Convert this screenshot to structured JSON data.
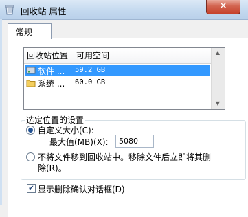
{
  "window": {
    "title": "回收站 属性",
    "close_glyph": "✕"
  },
  "tabs": [
    {
      "label": "常规"
    }
  ],
  "list": {
    "headers": {
      "location": "回收站位置",
      "space": "可用空间"
    },
    "rows": [
      {
        "name": "软件 ...",
        "space": "59.2 GB",
        "selected": true
      },
      {
        "name": "系统 ...",
        "space": "60.0 GB",
        "selected": false
      }
    ]
  },
  "settings": {
    "legend": "选定位置的设置",
    "custom_size_label": "自定义大小(C):",
    "max_value_label": "最大值(MB)(X):",
    "max_value": "5080",
    "no_move_label_line1": "不将文件移到回收站中。移除文件后立即将其删",
    "no_move_label_line2": "除(R)。",
    "selected_option": "custom"
  },
  "confirm": {
    "label": "显示删除确认对话框(D)",
    "checked": true
  }
}
